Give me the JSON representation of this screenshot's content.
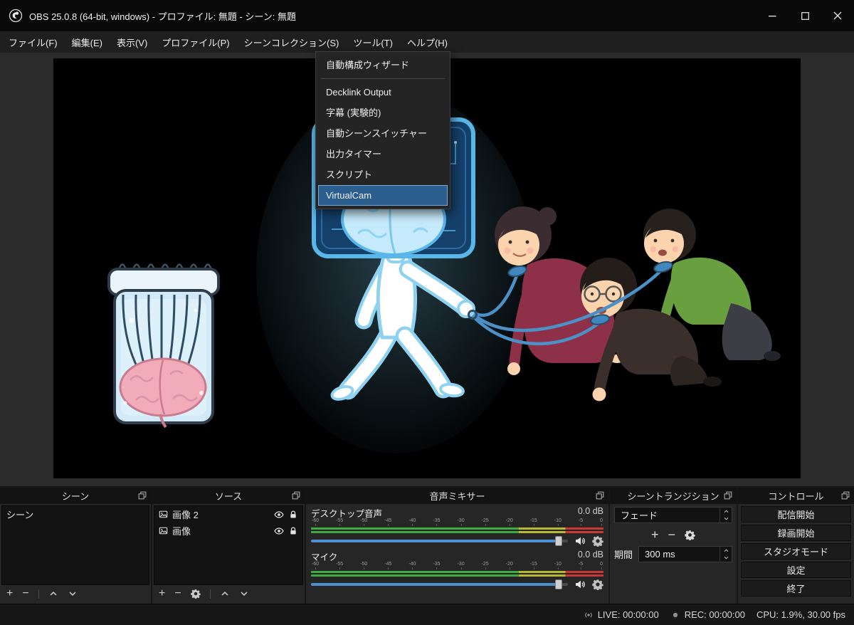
{
  "window": {
    "title": "OBS 25.0.8 (64-bit, windows) - プロファイル: 無題 - シーン: 無題"
  },
  "menu_bar": {
    "items": [
      {
        "label": "ファイル(F)"
      },
      {
        "label": "編集(E)"
      },
      {
        "label": "表示(V)"
      },
      {
        "label": "プロファイル(P)"
      },
      {
        "label": "シーンコレクション(S)"
      },
      {
        "label": "ツール(T)"
      },
      {
        "label": "ヘルプ(H)"
      }
    ]
  },
  "tools_menu": {
    "items": [
      {
        "label": "自動構成ウィザード",
        "highlighted": false
      },
      {
        "label": "Decklink Output",
        "highlighted": false
      },
      {
        "label": "字幕 (実験的)",
        "highlighted": false
      },
      {
        "label": "自動シーンスイッチャー",
        "highlighted": false
      },
      {
        "label": "出力タイマー",
        "highlighted": false
      },
      {
        "label": "スクリプト",
        "highlighted": false
      },
      {
        "label": "VirtualCam",
        "highlighted": true
      }
    ]
  },
  "preview": {
    "description": "Illustration: white AI figure with circuit-board brain head walking three crawling people on leashes; human brain in a jar on the left"
  },
  "docks": {
    "scenes": {
      "title": "シーン",
      "items": [
        "シーン"
      ],
      "toolbar": {
        "plus": "+",
        "minus": "−"
      }
    },
    "sources": {
      "title": "ソース",
      "items": [
        {
          "label": "画像 2"
        },
        {
          "label": "画像"
        }
      ],
      "toolbar": {
        "plus": "+",
        "minus": "−"
      }
    },
    "mixer": {
      "title": "音声ミキサー",
      "channels": [
        {
          "name": "デスクトップ音声",
          "level": "0.0 dB"
        },
        {
          "name": "マイク",
          "level": "0.0 dB"
        }
      ],
      "scale_ticks": [
        "-60",
        "-55",
        "-50",
        "-45",
        "-40",
        "-35",
        "-30",
        "-25",
        "-20",
        "-15",
        "-10",
        "-5",
        "0"
      ]
    },
    "transitions": {
      "title": "シーントランジション",
      "selected_transition": "フェード",
      "duration_label": "期間",
      "duration_value": "300 ms",
      "toolbar": {
        "plus": "+",
        "minus": "−"
      }
    },
    "controls": {
      "title": "コントロール",
      "buttons": [
        {
          "label": "配信開始"
        },
        {
          "label": "録画開始"
        },
        {
          "label": "スタジオモード"
        },
        {
          "label": "設定"
        },
        {
          "label": "終了"
        }
      ]
    }
  },
  "status_bar": {
    "live_label": "LIVE: 00:00:00",
    "rec_label": "REC: 00:00:00",
    "cpu_label": "CPU: 1.9%, 30.00 fps"
  },
  "colors": {
    "menu_highlight": "#2c5d8f",
    "slider_track": "#4f8fd0",
    "meter_green": "#41a941",
    "meter_yellow": "#b9b931",
    "meter_red": "#c93636"
  }
}
